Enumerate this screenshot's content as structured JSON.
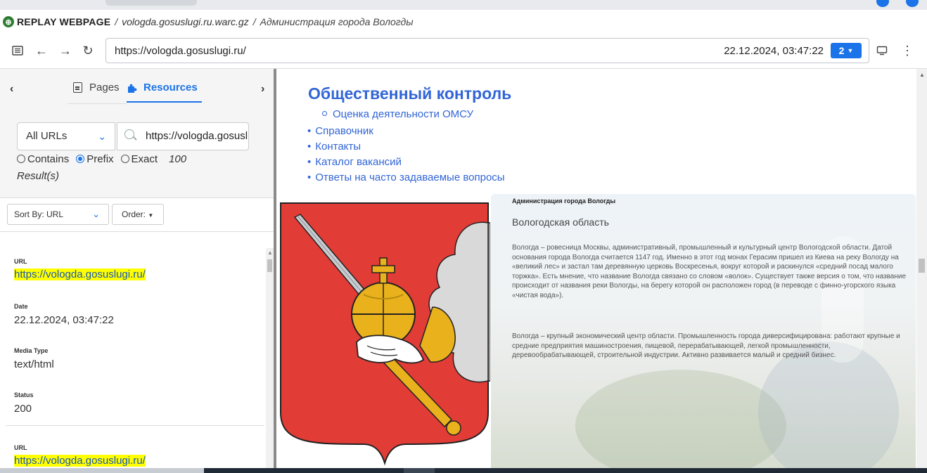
{
  "browser": {
    "tab_title_partial": "...",
    "ext_colors": [
      "#1a73e8"
    ]
  },
  "title_bar": {
    "brand": "REPLAY WEBPAGE",
    "separator": "/",
    "archive_name": "vologda.gosuslugi.ru.warc.gz",
    "page_title": "Администрация города Вологды"
  },
  "nav": {
    "url": "https://vologda.gosuslugi.ru/",
    "timestamp": "22.12.2024, 03:47:22",
    "capture_count": "2"
  },
  "sidebar": {
    "tab_pages_label": "Pages",
    "tab_resources_label": "Resources",
    "url_type_selected": "All URLs",
    "search_value": "https://vologda.gosuslugi.ru/",
    "match_modes": [
      "Contains",
      "Prefix",
      "Exact"
    ],
    "match_selected": "Prefix",
    "result_count": "100",
    "result_label": "Result(s)",
    "sort_label": "Sort By: URL",
    "order_label": "Order:",
    "result": {
      "url_label": "URL",
      "url_value": "https://vologda.gosuslugi.ru/",
      "date_label": "Date",
      "date_value": "22.12.2024, 03:47:22",
      "media_label": "Media Type",
      "media_value": "text/html",
      "status_label": "Status",
      "status_value": "200"
    },
    "result2": {
      "url_label": "URL",
      "url_value": "https://vologda.gosuslugi.ru/"
    }
  },
  "content": {
    "heading": "Общественный контроль",
    "sub_items": [
      "Оценка деятельности ОМСУ"
    ],
    "nav_items": [
      "Справочник",
      "Контакты",
      "Каталог вакансий",
      "Ответы на часто задаваемые вопросы"
    ],
    "org_name": "Администрация города Вологды",
    "region": "Вологодская область",
    "paragraph_1": "Вологда – ровесница Москвы, административный, промышленный и культурный центр Вологодской области. Датой основания города Вологда считается 1147 год. Именно в этот год монах Герасим пришел из Киева на реку Вологду на «великий лес» и застал там деревянную церковь Воскресенья, вокруг которой и раскинулся «средний посад малого торжка». Есть мнение, что название Вологда связано со словом «волок». Существует также версия о том, что название происходит от названия реки Вологды, на берегу которой он расположен город (в переводе с финно-угорского языка «чистая вода»).",
    "paragraph_2": "Вологда – крупный экономический центр области. Промышленность города диверсифицирована: работают крупные и средние предприятия машиностроения, пищевой, перерабатывающей, легкой промышленности, деревообрабатывающей, строительной индустрии. Активно развивается малый и средний бизнес.",
    "link_color": "#3165d6",
    "coat_colors": {
      "shield": "#e23c37",
      "orb": "#e9b21c",
      "sword": "#b9bec2"
    }
  }
}
